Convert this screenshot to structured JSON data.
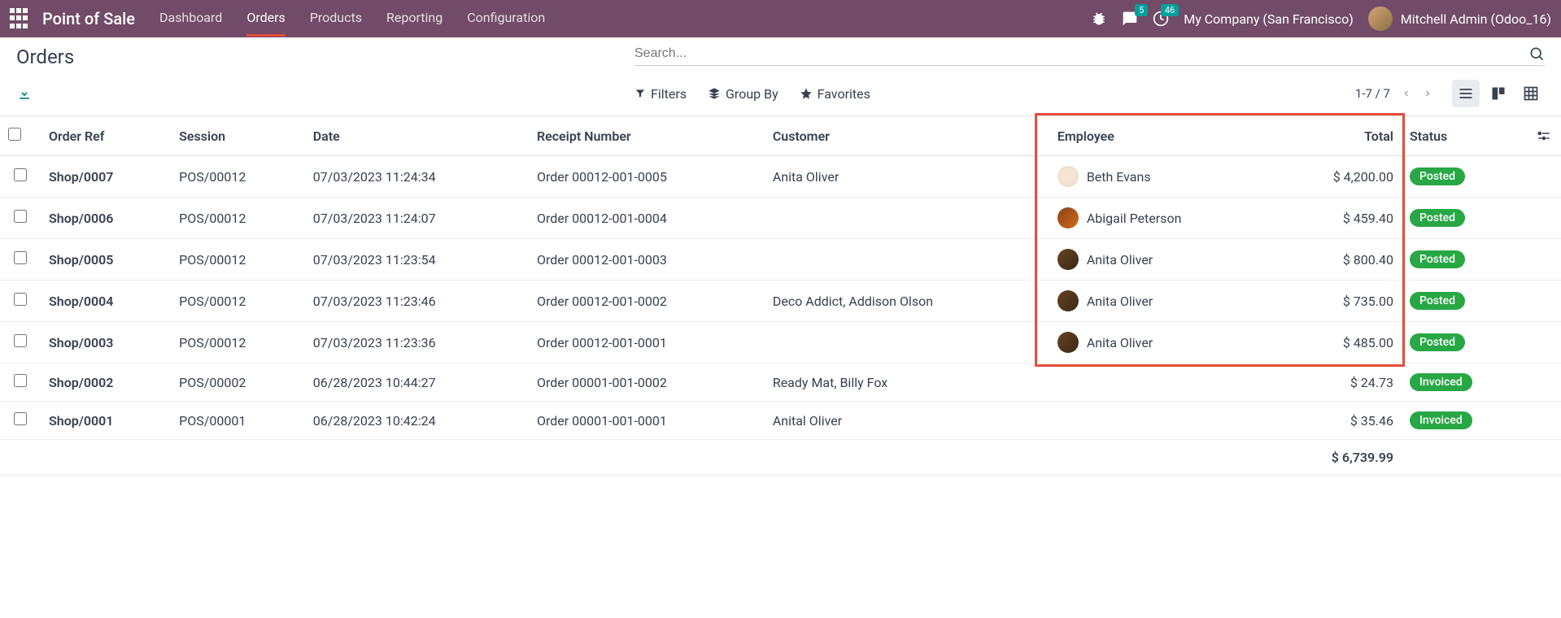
{
  "navbar": {
    "brand": "Point of Sale",
    "items": [
      "Dashboard",
      "Orders",
      "Products",
      "Reporting",
      "Configuration"
    ],
    "active_index": 1,
    "msg_badge": "5",
    "activity_badge": "46",
    "company": "My Company (San Francisco)",
    "username": "Mitchell Admin (Odoo_16)"
  },
  "page": {
    "title": "Orders",
    "search_placeholder": "Search...",
    "filters_label": "Filters",
    "groupby_label": "Group By",
    "favorites_label": "Favorites",
    "pager": "1-7 / 7"
  },
  "table": {
    "headers": {
      "ref": "Order Ref",
      "session": "Session",
      "date": "Date",
      "receipt": "Receipt Number",
      "customer": "Customer",
      "employee": "Employee",
      "total": "Total",
      "status": "Status"
    },
    "rows": [
      {
        "ref": "Shop/0007",
        "session": "POS/00012",
        "date": "07/03/2023 11:24:34",
        "receipt": "Order 00012-001-0005",
        "customer": "Anita Oliver",
        "employee": "Beth Evans",
        "emp_cls": "a1",
        "total": "$ 4,200.00",
        "status": "Posted",
        "status_cls": "posted"
      },
      {
        "ref": "Shop/0006",
        "session": "POS/00012",
        "date": "07/03/2023 11:24:07",
        "receipt": "Order 00012-001-0004",
        "customer": "",
        "employee": "Abigail Peterson",
        "emp_cls": "a2",
        "total": "$ 459.40",
        "status": "Posted",
        "status_cls": "posted"
      },
      {
        "ref": "Shop/0005",
        "session": "POS/00012",
        "date": "07/03/2023 11:23:54",
        "receipt": "Order 00012-001-0003",
        "customer": "",
        "employee": "Anita Oliver",
        "emp_cls": "a3",
        "total": "$ 800.40",
        "status": "Posted",
        "status_cls": "posted"
      },
      {
        "ref": "Shop/0004",
        "session": "POS/00012",
        "date": "07/03/2023 11:23:46",
        "receipt": "Order 00012-001-0002",
        "customer": "Deco Addict, Addison Olson",
        "employee": "Anita Oliver",
        "emp_cls": "a3",
        "total": "$ 735.00",
        "status": "Posted",
        "status_cls": "posted"
      },
      {
        "ref": "Shop/0003",
        "session": "POS/00012",
        "date": "07/03/2023 11:23:36",
        "receipt": "Order 00012-001-0001",
        "customer": "",
        "employee": "Anita Oliver",
        "emp_cls": "a3",
        "total": "$ 485.00",
        "status": "Posted",
        "status_cls": "posted"
      },
      {
        "ref": "Shop/0002",
        "session": "POS/00002",
        "date": "06/28/2023 10:44:27",
        "receipt": "Order 00001-001-0002",
        "customer": "Ready Mat, Billy Fox",
        "employee": "",
        "emp_cls": "",
        "total": "$ 24.73",
        "status": "Invoiced",
        "status_cls": "invoiced"
      },
      {
        "ref": "Shop/0001",
        "session": "POS/00001",
        "date": "06/28/2023 10:42:24",
        "receipt": "Order 00001-001-0001",
        "customer": "Anital Oliver",
        "employee": "",
        "emp_cls": "",
        "total": "$ 35.46",
        "status": "Invoiced",
        "status_cls": "invoiced"
      }
    ],
    "footer_total": "$ 6,739.99"
  }
}
